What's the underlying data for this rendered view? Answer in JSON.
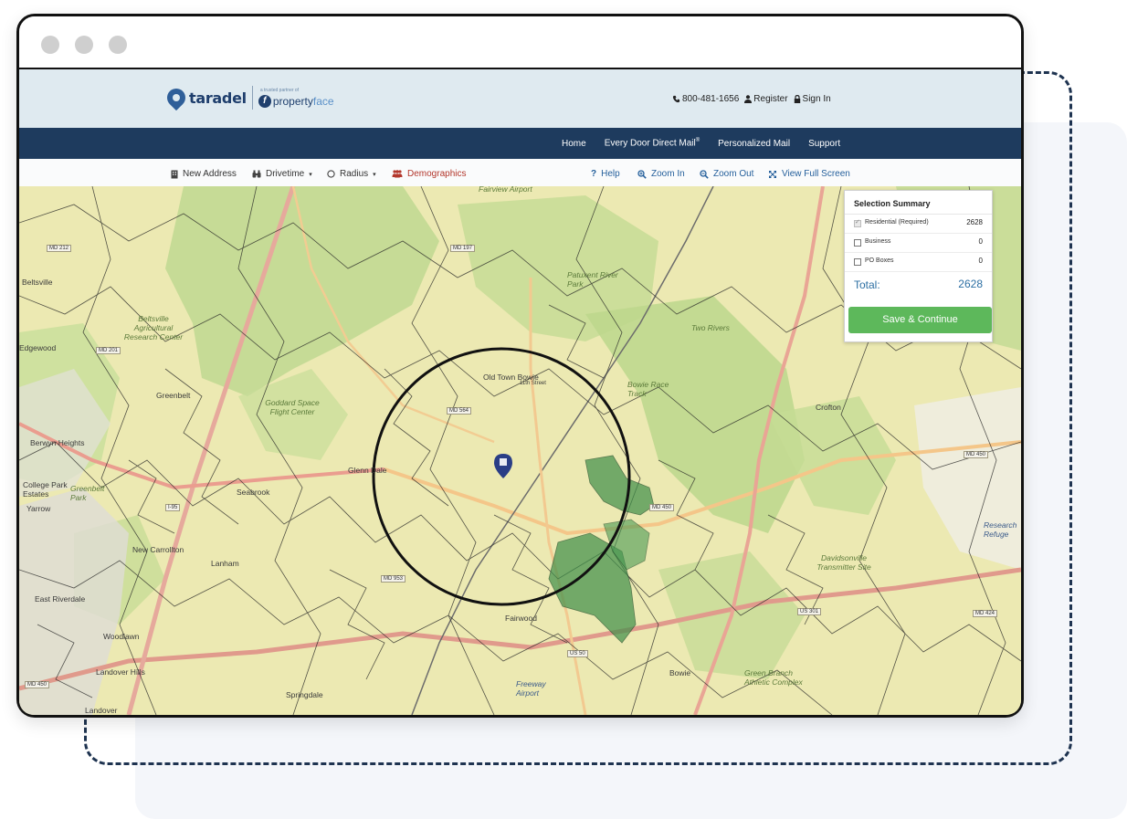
{
  "header": {
    "brand_name": "taradel",
    "partner_tagline": "a trusted partner of",
    "partner_name_a": "property",
    "partner_name_b": "face",
    "partner_icon": "f",
    "phone": "800-481-1656",
    "register": "Register",
    "sign_in": "Sign In"
  },
  "nav": {
    "items": [
      "Home",
      "Every Door Direct Mail",
      "Personalized Mail",
      "Support"
    ],
    "edm_mark": "®"
  },
  "toolbar": {
    "new_address": "New Address",
    "drivetime": "Drivetime",
    "radius": "Radius",
    "demographics": "Demographics",
    "help": "Help",
    "zoom_in": "Zoom In",
    "zoom_out": "Zoom Out",
    "full_screen": "View Full Screen"
  },
  "map": {
    "labels": [
      "Beltsville",
      "Edgewood",
      "Greenbelt",
      "Berwyn Heights",
      "College Park Estates",
      "Greenbelt Park",
      "Yarrow",
      "Glenn Dale",
      "Seabrook",
      "New Carrollton",
      "Lanham",
      "East Riverdale",
      "Woodlawn",
      "Landover Hills",
      "Landover",
      "Springdale",
      "Fairwood",
      "Old Town Bowie",
      "Bowie",
      "Crofton",
      "Davidsonville Transmitter Site",
      "Fairview Airport",
      "Research Refuge",
      "Goddard Space Flight Center",
      "Beltsville Agricultural Research Center",
      "Patuxent River Park",
      "Two Rivers",
      "Bowie Race Track",
      "Freeway Airport",
      "Green Branch Athletic Complex",
      "11th Street"
    ],
    "road_badges": [
      "MD 212",
      "MD 201",
      "MD 197",
      "MD 564",
      "MD 450",
      "MD 953",
      "US 50",
      "US 301",
      "MD 424",
      "MD 450",
      "I-95",
      "MD 450"
    ]
  },
  "summary": {
    "title": "Selection Summary",
    "rows": [
      {
        "label": "Residential (Required)",
        "value": "2628",
        "checked": true
      },
      {
        "label": "Business",
        "value": "0",
        "checked": false
      },
      {
        "label": "PO Boxes",
        "value": "0",
        "checked": false
      }
    ],
    "total_label": "Total:",
    "total_value": "2628",
    "save_label": "Save & Continue"
  },
  "colors": {
    "navbar": "#1e3b5e",
    "header_bg": "#dfeaf0",
    "save_button": "#5db85b",
    "total_text": "#2d6fa3",
    "demographics": "#b3372c",
    "selection_green": "#3f8f4a"
  }
}
